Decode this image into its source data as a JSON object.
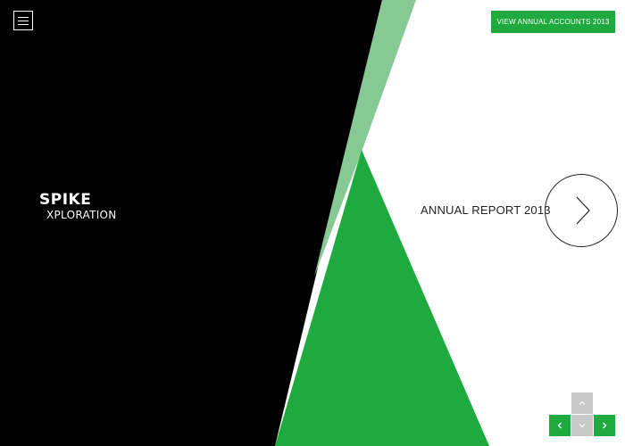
{
  "header": {
    "menu_icon": "hamburger-icon",
    "accounts_button_label": "VIEW ANNUAL ACCOUNTS 2013"
  },
  "logo": {
    "main": "SPIKE",
    "sub": "XPLORATION"
  },
  "hero": {
    "title": "ANNUAL REPORT 2013",
    "next_icon": "chevron-right-icon"
  },
  "pager": {
    "up_icon": "chevron-up-icon",
    "down_icon": "chevron-down-icon",
    "left_icon": "chevron-left-icon",
    "right_icon": "chevron-right-icon"
  },
  "colors": {
    "brand_green": "#1faa3f",
    "light_green": "#86c995",
    "panel_black": "#000000",
    "pager_grey": "#c8c8c8"
  }
}
